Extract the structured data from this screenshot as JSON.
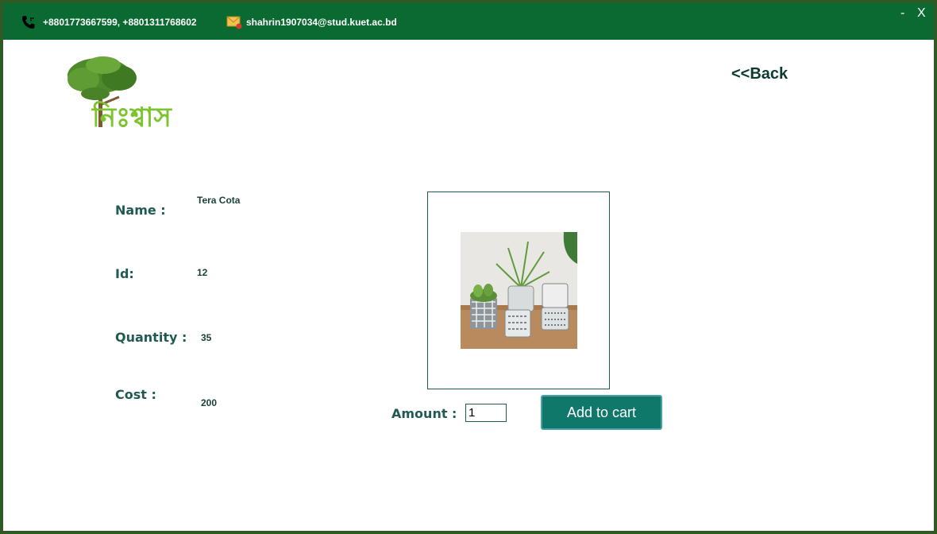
{
  "topbar": {
    "phone_icon": "phone-icon",
    "phone": "+8801773667599, +8801311768602",
    "mail_icon": "mail-icon",
    "email": "shahrin1907034@stud.kuet.ac.bd",
    "minimize_label": "-",
    "close_label": "X"
  },
  "brand": {
    "logo_text": "নিঃশ্বাস",
    "accent_color": "#0a6a32"
  },
  "nav": {
    "back_label": "<<Back"
  },
  "product": {
    "name_label": "Name :",
    "name": "Tera Cota",
    "id_label": "Id:",
    "id": "12",
    "quantity_label": "Quantity :",
    "quantity": "35",
    "cost_label": "Cost :",
    "cost": "200",
    "image": "potted-plants-photo"
  },
  "order": {
    "amount_label": "Amount :",
    "amount_value": "1",
    "add_to_cart_label": "Add to cart"
  }
}
